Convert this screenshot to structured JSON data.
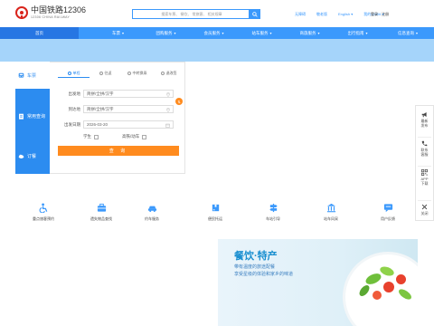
{
  "header": {
    "logo_title": "中国铁路12306",
    "logo_sub": "12306 CHINA RAILWAY",
    "search_placeholder": "搜索车票、 餐饮、 常旅客、 相关规章",
    "links": [
      "无障碍",
      "敬老版",
      "English ▾",
      "我的12306 ▾"
    ],
    "login": "登录",
    "register": "注册"
  },
  "nav": {
    "items": [
      {
        "label": "首页",
        "arrow": ""
      },
      {
        "label": "车票",
        "arrow": "▾"
      },
      {
        "label": "团购服务",
        "arrow": "▾"
      },
      {
        "label": "会员服务",
        "arrow": "▾"
      },
      {
        "label": "站车服务",
        "arrow": "▾"
      },
      {
        "label": "商旅服务",
        "arrow": "▾"
      },
      {
        "label": "出行指南",
        "arrow": "▾"
      },
      {
        "label": "信息查询",
        "arrow": "▾"
      }
    ]
  },
  "booking": {
    "side_tabs": [
      "车票",
      "常用查询",
      "订餐"
    ],
    "ticket_types": [
      "单程",
      "往返",
      "中转换乘",
      "退改签"
    ],
    "from_label": "出发地",
    "from_value": "简拼/全拼/汉字",
    "to_label": "到达地",
    "to_value": "简拼/全拼/汉字",
    "date_label": "出发日期",
    "date_value": "2026-03-20",
    "student_label": "学生",
    "highspeed_label": "高铁/动车",
    "swap_symbol": "⇅",
    "query_label": "查 询"
  },
  "services": [
    {
      "label": "重点旅客预约",
      "icon": "accessibility-icon"
    },
    {
      "label": "遗失物品查找",
      "icon": "briefcase-icon"
    },
    {
      "label": "约车服务",
      "icon": "car-icon"
    },
    {
      "label": "便民托运",
      "icon": "package-icon"
    },
    {
      "label": "车站引导",
      "icon": "signpost-icon"
    },
    {
      "label": "站车风采",
      "icon": "station-icon"
    },
    {
      "label": "用户反馈",
      "icon": "feedback-icon"
    }
  ],
  "ad": {
    "title": "餐饮·特产",
    "line1": "带有温度的旅途配餐",
    "line2": "享受星级的体验和家乡的味道"
  },
  "floatbar": [
    {
      "label1": "最新",
      "label2": "发布",
      "icon": "megaphone-icon"
    },
    {
      "label1": "联系",
      "label2": "客服",
      "icon": "phone-icon"
    },
    {
      "label1": "APP",
      "label2": "下载",
      "icon": "qrcode-icon"
    },
    {
      "label1": "关闭",
      "label2": "",
      "icon": "close-icon"
    }
  ],
  "colors": {
    "primary": "#3b99fc",
    "accent": "#ff8b1e",
    "brand_red": "#d9241c"
  }
}
